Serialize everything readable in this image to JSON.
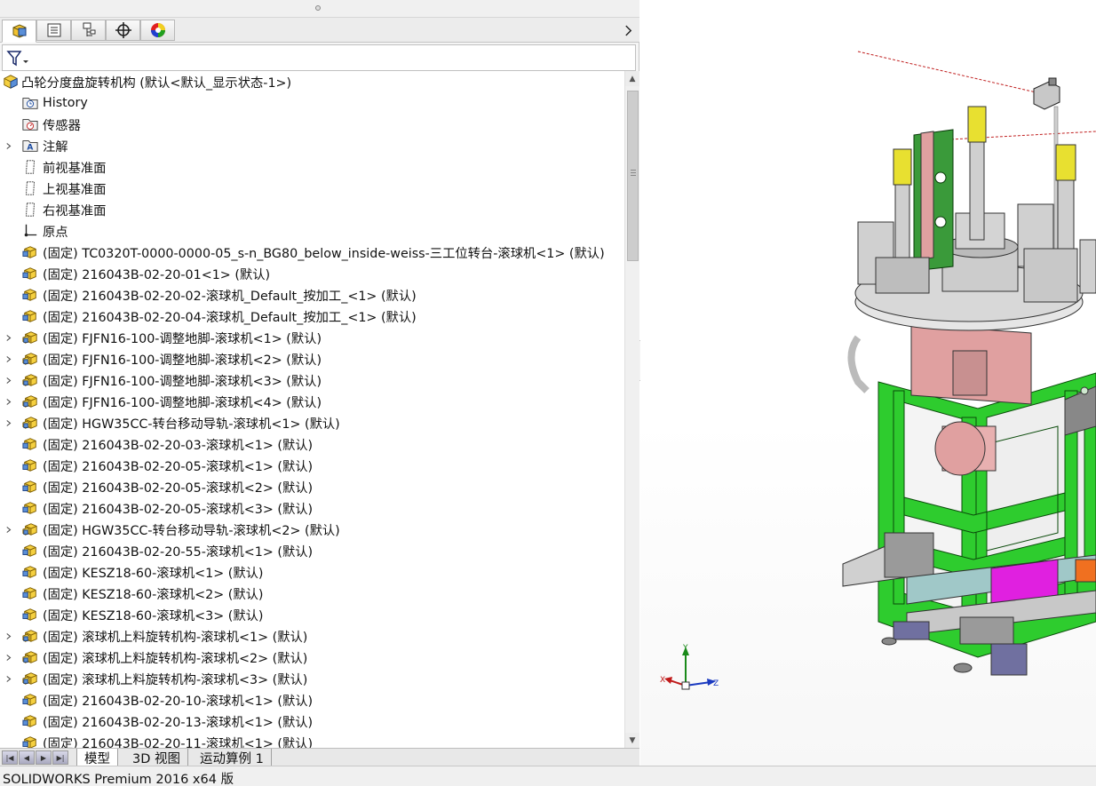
{
  "tree": {
    "root": {
      "label": "凸轮分度盘旋转机构  (默认<默认_显示状态-1>)"
    },
    "items": [
      {
        "label": "History",
        "icon": "history-folder-icon",
        "expandable": false
      },
      {
        "label": "传感器",
        "icon": "sensor-folder-icon",
        "expandable": false
      },
      {
        "label": "注解",
        "icon": "annotation-folder-icon",
        "expandable": true
      },
      {
        "label": "前视基准面",
        "icon": "plane-icon",
        "expandable": false
      },
      {
        "label": "上视基准面",
        "icon": "plane-icon",
        "expandable": false
      },
      {
        "label": "右视基准面",
        "icon": "plane-icon",
        "expandable": false
      },
      {
        "label": "原点",
        "icon": "origin-icon",
        "expandable": false
      },
      {
        "label": "(固定) TC0320T-0000-0000-05_s-n_BG80_below_inside-weiss-三工位转台-滚球机<1> (默认)",
        "icon": "part-icon",
        "expandable": false
      },
      {
        "label": "(固定) 216043B-02-20-01<1> (默认)",
        "icon": "part-icon",
        "expandable": false
      },
      {
        "label": "(固定) 216043B-02-20-02-滚球机_Default_按加工_<1> (默认)",
        "icon": "part-icon",
        "expandable": false
      },
      {
        "label": "(固定) 216043B-02-20-04-滚球机_Default_按加工_<1> (默认)",
        "icon": "part-icon",
        "expandable": false
      },
      {
        "label": "(固定) FJFN16-100-调整地脚-滚球机<1> (默认)",
        "icon": "assembly-icon",
        "expandable": true
      },
      {
        "label": "(固定) FJFN16-100-调整地脚-滚球机<2> (默认)",
        "icon": "assembly-icon",
        "expandable": true
      },
      {
        "label": "(固定) FJFN16-100-调整地脚-滚球机<3> (默认)",
        "icon": "assembly-icon",
        "expandable": true
      },
      {
        "label": "(固定) FJFN16-100-调整地脚-滚球机<4> (默认)",
        "icon": "assembly-icon",
        "expandable": true
      },
      {
        "label": "(固定) HGW35CC-转台移动导轨-滚球机<1> (默认)",
        "icon": "assembly-icon",
        "expandable": true
      },
      {
        "label": "(固定) 216043B-02-20-03-滚球机<1> (默认)",
        "icon": "part-icon",
        "expandable": false
      },
      {
        "label": "(固定) 216043B-02-20-05-滚球机<1> (默认)",
        "icon": "part-icon",
        "expandable": false
      },
      {
        "label": "(固定) 216043B-02-20-05-滚球机<2> (默认)",
        "icon": "part-icon",
        "expandable": false
      },
      {
        "label": "(固定) 216043B-02-20-05-滚球机<3> (默认)",
        "icon": "part-icon",
        "expandable": false
      },
      {
        "label": "(固定) HGW35CC-转台移动导轨-滚球机<2> (默认)",
        "icon": "assembly-icon",
        "expandable": true
      },
      {
        "label": "(固定) 216043B-02-20-55-滚球机<1> (默认)",
        "icon": "part-icon",
        "expandable": false
      },
      {
        "label": "(固定) KESZ18-60-滚球机<1> (默认)",
        "icon": "part-icon",
        "expandable": false
      },
      {
        "label": "(固定) KESZ18-60-滚球机<2> (默认)",
        "icon": "part-icon",
        "expandable": false
      },
      {
        "label": "(固定) KESZ18-60-滚球机<3> (默认)",
        "icon": "part-icon",
        "expandable": false
      },
      {
        "label": "(固定) 滚球机上料旋转机构-滚球机<1> (默认)",
        "icon": "assembly-icon",
        "expandable": true
      },
      {
        "label": "(固定) 滚球机上料旋转机构-滚球机<2> (默认)",
        "icon": "assembly-icon",
        "expandable": true
      },
      {
        "label": "(固定) 滚球机上料旋转机构-滚球机<3> (默认)",
        "icon": "assembly-icon",
        "expandable": true
      },
      {
        "label": "(固定) 216043B-02-20-10-滚球机<1> (默认)",
        "icon": "part-icon",
        "expandable": false
      },
      {
        "label": "(固定) 216043B-02-20-13-滚球机<1> (默认)",
        "icon": "part-icon",
        "expandable": false
      },
      {
        "label": "(固定) 216043B-02-20-11-滚球机<1> (默认)",
        "icon": "part-icon",
        "expandable": false
      }
    ]
  },
  "manager_tabs": [
    {
      "name": "feature-manager-tab",
      "icon": "assembly-tree-icon",
      "active": true
    },
    {
      "name": "property-manager-tab",
      "icon": "property-list-icon",
      "active": false
    },
    {
      "name": "configuration-manager-tab",
      "icon": "configuration-icon",
      "active": false
    },
    {
      "name": "dimxpert-manager-tab",
      "icon": "crosshair-icon",
      "active": false
    },
    {
      "name": "display-manager-tab",
      "icon": "color-wheel-icon",
      "active": false
    }
  ],
  "bottom_tabs": [
    {
      "label": "模型",
      "active": true
    },
    {
      "label": "3D 视图",
      "active": false
    },
    {
      "label": "运动算例 1",
      "active": false
    }
  ],
  "status": {
    "text": "SOLIDWORKS Premium 2016 x64 版"
  },
  "triad": {
    "x_label": "X",
    "y_label": "Y",
    "z_label": "Z"
  },
  "colors": {
    "frame_green": "#2ecc2e",
    "bracket_green": "#3a9a3a",
    "cylinder_yellow": "#e8e030",
    "base_pink": "#e0a0a0",
    "magenta": "#e020e0",
    "orange": "#f07020",
    "plate_gray": "#d8d8d8"
  }
}
